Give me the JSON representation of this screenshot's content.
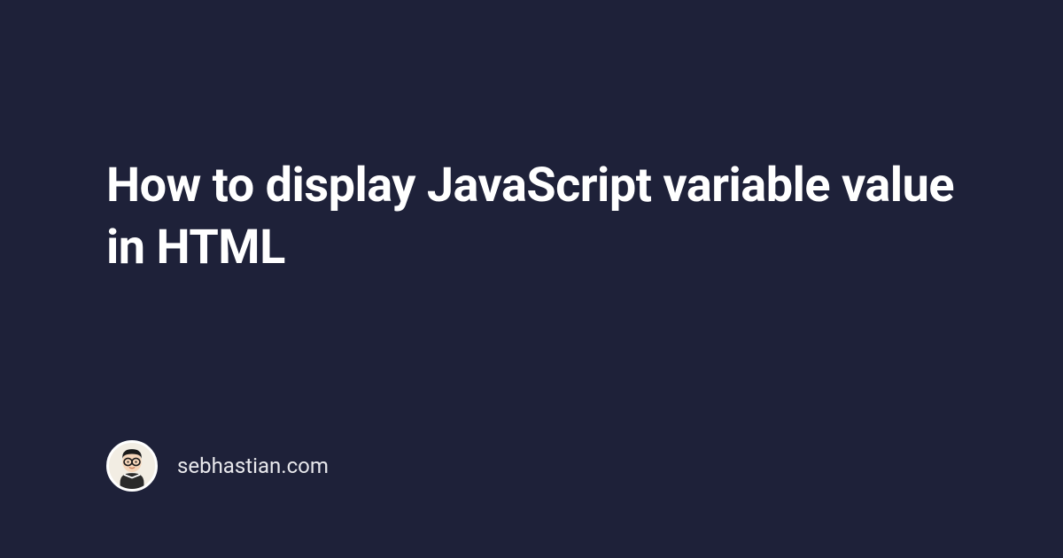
{
  "title": "How to display JavaScript variable value in HTML",
  "site_name": "sebhastian.com"
}
